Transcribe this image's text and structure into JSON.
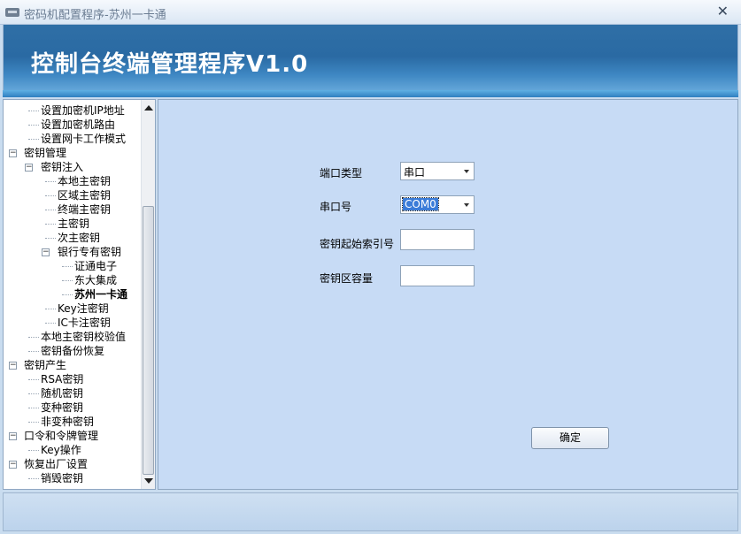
{
  "window": {
    "title": "密码机配置程序-苏州一卡通",
    "close_label": "✕"
  },
  "banner": {
    "title": "控制台终端管理程序V1.0"
  },
  "tree": {
    "items": [
      {
        "label": "设置加密机IP地址",
        "level": 2,
        "expander": ""
      },
      {
        "label": "设置加密机路由",
        "level": 2,
        "expander": ""
      },
      {
        "label": "设置网卡工作模式",
        "level": 2,
        "expander": ""
      },
      {
        "label": "密钥管理",
        "level": 1,
        "expander": "−"
      },
      {
        "label": "密钥注入",
        "level": 2,
        "expander": "−"
      },
      {
        "label": "本地主密钥",
        "level": 3,
        "expander": ""
      },
      {
        "label": "区域主密钥",
        "level": 3,
        "expander": ""
      },
      {
        "label": "终端主密钥",
        "level": 3,
        "expander": ""
      },
      {
        "label": "主密钥",
        "level": 3,
        "expander": ""
      },
      {
        "label": "次主密钥",
        "level": 3,
        "expander": ""
      },
      {
        "label": "银行专有密钥",
        "level": 3,
        "expander": "−"
      },
      {
        "label": "证通电子",
        "level": 4,
        "expander": ""
      },
      {
        "label": "东大集成",
        "level": 4,
        "expander": ""
      },
      {
        "label": "苏州一卡通",
        "level": 4,
        "expander": "",
        "selected": true
      },
      {
        "label": "Key注密钥",
        "level": 3,
        "expander": ""
      },
      {
        "label": "IC卡注密钥",
        "level": 3,
        "expander": ""
      },
      {
        "label": "本地主密钥校验值",
        "level": 2,
        "expander": ""
      },
      {
        "label": "密钥备份恢复",
        "level": 2,
        "expander": ""
      },
      {
        "label": "密钥产生",
        "level": 1,
        "expander": "−"
      },
      {
        "label": "RSA密钥",
        "level": 2,
        "expander": ""
      },
      {
        "label": "随机密钥",
        "level": 2,
        "expander": ""
      },
      {
        "label": "变种密钥",
        "level": 2,
        "expander": ""
      },
      {
        "label": "非变种密钥",
        "level": 2,
        "expander": ""
      },
      {
        "label": "口令和令牌管理",
        "level": 1,
        "expander": "−"
      },
      {
        "label": "Key操作",
        "level": 2,
        "expander": ""
      },
      {
        "label": "恢复出厂设置",
        "level": 1,
        "expander": "−"
      },
      {
        "label": "销毁密钥",
        "level": 2,
        "expander": ""
      }
    ]
  },
  "form": {
    "port_type_label": "端口类型",
    "port_type_value": "串口",
    "serial_port_label": "串口号",
    "serial_port_value": "COM0",
    "key_start_index_label": "密钥起始索引号",
    "key_start_index_value": "",
    "key_area_capacity_label": "密钥区容量",
    "key_area_capacity_value": "",
    "ok_label": "确定"
  }
}
